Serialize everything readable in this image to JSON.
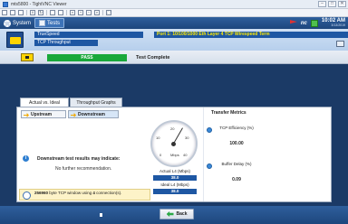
{
  "window": {
    "title": "mts5800 - TightVNC Viewer"
  },
  "toolbar": {
    "icons": [
      "new-connection-icon",
      "save-icon",
      "options-icon",
      "pause-icon",
      "refresh-icon",
      "ctrl-icon",
      "alt-icon",
      "zoom-icon",
      "zoom-in-icon",
      "zoom-out-icon",
      "zoom-fit-icon",
      "fullscreen-icon"
    ]
  },
  "topbar": {
    "system_label": "System",
    "tests_label": "Tests",
    "nc_label": "nc",
    "time": "10:02 AM",
    "date": "3/13/2019"
  },
  "test_header": {
    "line1": "TrueSpeed",
    "line2": "TCP Throughput",
    "port_info": "Port 1: 10/100/1000 Eth Layer 4 TCP Wirespeed Term"
  },
  "status_row": {
    "pass_label": "PASS",
    "status_text": "Test Complete"
  },
  "tabs": {
    "actual_vs_ideal": "Actual vs. Ideal",
    "throughput_graphs": "Throughput Graphs"
  },
  "subtabs": {
    "upstream": "Upstream",
    "downstream": "Downstream"
  },
  "left_panel": {
    "indicate": "Downstream test results may indicate:",
    "recommendation": "No further recommendation.",
    "window_bytes": "256960",
    "window_text_a": " byte TCP window using ",
    "connections": "4",
    "window_text_b": " connection(s)."
  },
  "gauge": {
    "ticks": [
      "0",
      "10",
      "20",
      "30",
      "40"
    ],
    "unit": "Mbps",
    "actual_label": "Actual L4 (Mbps)",
    "actual_value": "38.0",
    "ideal_label": "Ideal L4 (Mbps)",
    "ideal_value": "38.0"
  },
  "transfer_metrics": {
    "title": "Transfer Metrics",
    "efficiency_label": "TCP Efficiency (%)",
    "efficiency_value": "100.00",
    "buffer_label": "Buffer Delay (%)",
    "buffer_value": "0.09"
  },
  "bottom": {
    "back_label": "Back"
  }
}
